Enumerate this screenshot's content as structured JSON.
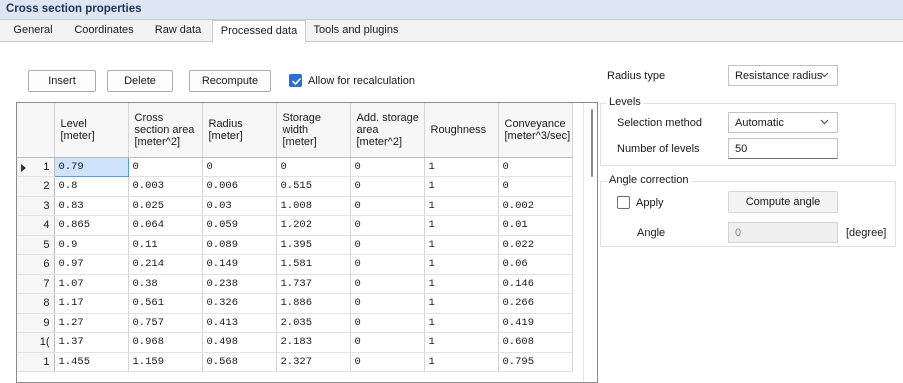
{
  "window": {
    "title": "Cross section properties"
  },
  "tabs": [
    {
      "label": "General"
    },
    {
      "label": "Coordinates"
    },
    {
      "label": "Raw data"
    },
    {
      "label": "Processed data"
    },
    {
      "label": "Tools and plugins"
    }
  ],
  "active_tab": "Processed data",
  "toolbar": {
    "insert_label": "Insert",
    "delete_label": "Delete",
    "recompute_label": "Recompute",
    "allow_recalc_label": "Allow for recalculation",
    "allow_recalc_checked": true
  },
  "grid": {
    "columns": [
      "Level\n[meter]",
      "Cross\nsection area\n[meter^2]",
      "Radius\n[meter]",
      "Storage\nwidth\n[meter]",
      "Add. storage\narea\n[meter^2]",
      "Roughness",
      "Conveyance\n[meter^3/sec]"
    ],
    "row_numbers": [
      "1",
      "2",
      "3",
      "4",
      "5",
      "6",
      "7",
      "8",
      "9",
      "1(",
      "1"
    ],
    "rows": [
      [
        "0.79",
        "0",
        "0",
        "0",
        "0",
        "1",
        "0"
      ],
      [
        "0.8",
        "0.003",
        "0.006",
        "0.515",
        "0",
        "1",
        "0"
      ],
      [
        "0.83",
        "0.025",
        "0.03",
        "1.008",
        "0",
        "1",
        "0.002"
      ],
      [
        "0.865",
        "0.064",
        "0.059",
        "1.202",
        "0",
        "1",
        "0.01"
      ],
      [
        "0.9",
        "0.11",
        "0.089",
        "1.395",
        "0",
        "1",
        "0.022"
      ],
      [
        "0.97",
        "0.214",
        "0.149",
        "1.581",
        "0",
        "1",
        "0.06"
      ],
      [
        "1.07",
        "0.38",
        "0.238",
        "1.737",
        "0",
        "1",
        "0.146"
      ],
      [
        "1.17",
        "0.561",
        "0.326",
        "1.886",
        "0",
        "1",
        "0.266"
      ],
      [
        "1.27",
        "0.757",
        "0.413",
        "2.035",
        "0",
        "1",
        "0.419"
      ],
      [
        "1.37",
        "0.968",
        "0.498",
        "2.183",
        "0",
        "1",
        "0.608"
      ],
      [
        "1.455",
        "1.159",
        "0.568",
        "2.327",
        "0",
        "1",
        "0.795"
      ]
    ],
    "current_row": 0
  },
  "right_panel": {
    "radius_type_label": "Radius type",
    "radius_type_value": "Resistance radius",
    "levels_group_label": "Levels",
    "selection_method_label": "Selection method",
    "selection_method_value": "Automatic",
    "number_of_levels_label": "Number of levels",
    "number_of_levels_value": "50",
    "angle_group_label": "Angle correction",
    "apply_label": "Apply",
    "apply_checked": false,
    "compute_angle_label": "Compute angle",
    "angle_label": "Angle",
    "angle_value": "0",
    "angle_unit": "[degree]"
  },
  "colors": {
    "accent": "#2a6fd6",
    "selection": "#cde4fb",
    "title_bg": "#dde6f2"
  }
}
